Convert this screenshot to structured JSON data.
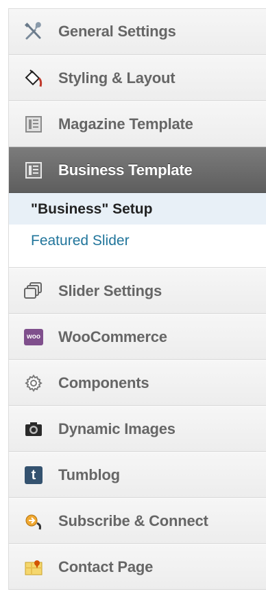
{
  "menu": {
    "items": [
      {
        "label": "General Settings",
        "icon": "tools-icon"
      },
      {
        "label": "Styling & Layout",
        "icon": "paint-bucket-icon"
      },
      {
        "label": "Magazine Template",
        "icon": "layout-template-icon"
      },
      {
        "label": "Business Template",
        "icon": "layout-template-icon",
        "active": true
      },
      {
        "label": "Slider Settings",
        "icon": "slides-icon"
      },
      {
        "label": "WooCommerce",
        "icon": "woocommerce-icon",
        "icon_text": "woo"
      },
      {
        "label": "Components",
        "icon": "gear-icon"
      },
      {
        "label": "Dynamic Images",
        "icon": "camera-icon"
      },
      {
        "label": "Tumblog",
        "icon": "tumblr-icon",
        "icon_text": "t"
      },
      {
        "label": "Subscribe & Connect",
        "icon": "subscribe-icon"
      },
      {
        "label": "Contact Page",
        "icon": "contact-map-icon"
      }
    ],
    "submenu": [
      {
        "label": "\"Business\" Setup",
        "current": true
      },
      {
        "label": "Featured Slider",
        "current": false
      }
    ]
  },
  "colors": {
    "active_bg": "#6a6a6a",
    "link": "#21759b",
    "current_sub_bg": "#e8f0f7"
  }
}
